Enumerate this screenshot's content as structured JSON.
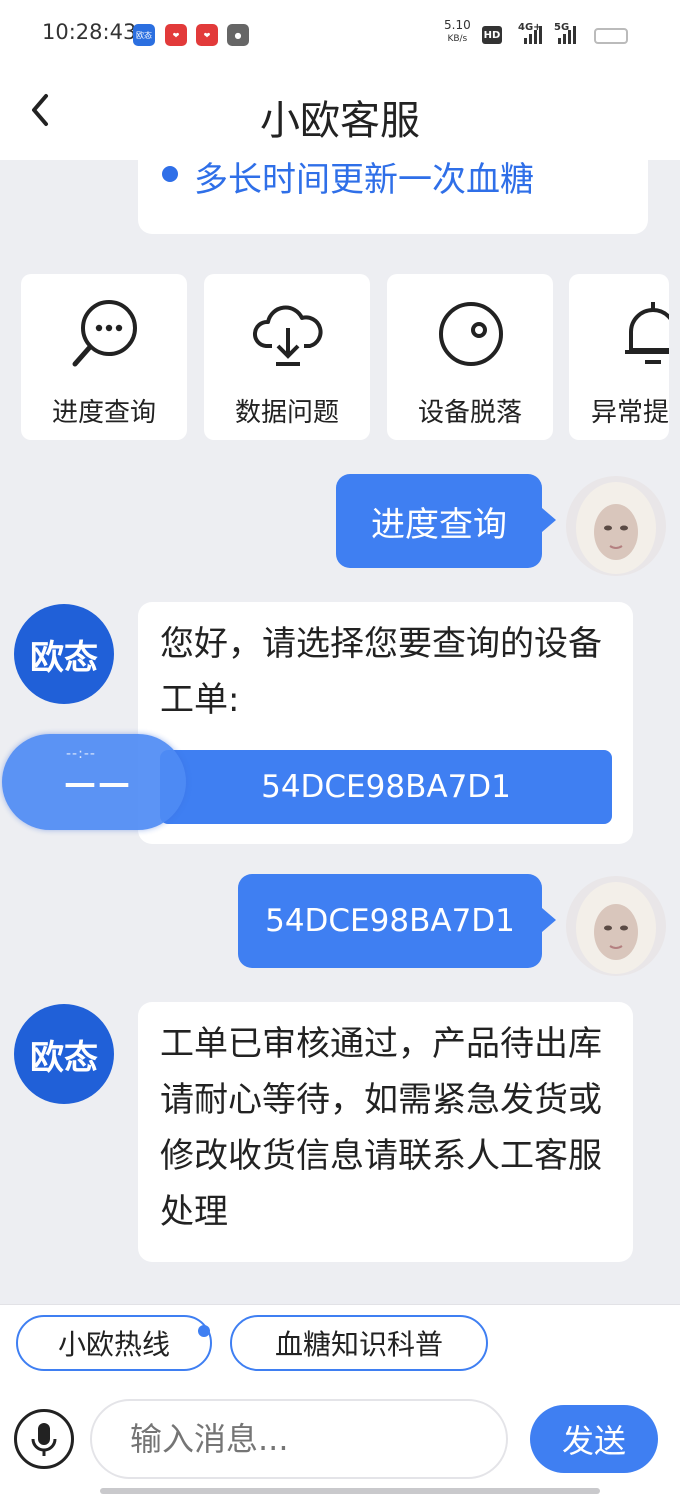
{
  "status_bar": {
    "time": "10:28:43",
    "apps": [
      {
        "name": "oudtai-app-icon",
        "label": "欧态",
        "color": "#2b6fe0"
      },
      {
        "name": "red-app-icon-1",
        "label": "",
        "color": "#e23a3a"
      },
      {
        "name": "red-app-icon-2",
        "label": "",
        "color": "#e23a3a"
      },
      {
        "name": "gray-app-icon",
        "label": "",
        "color": "#666666"
      }
    ],
    "net_speed_value": "5.10",
    "net_speed_unit": "KB/s",
    "hd_label": "HD",
    "sim_1": "4G+",
    "sim_2": "5G"
  },
  "header": {
    "back_icon": "chevron-left-icon",
    "title": "小欧客服"
  },
  "top_card": {
    "text": "多长时间更新一次血糖"
  },
  "quick_actions": [
    {
      "label": "进度查询",
      "icon": "search-chat-icon"
    },
    {
      "label": "数据问题",
      "icon": "cloud-download-icon"
    },
    {
      "label": "设备脱落",
      "icon": "disc-icon"
    },
    {
      "label": "异常提",
      "icon": "bell-icon"
    }
  ],
  "messages": {
    "user_1": "进度查询",
    "bot_avatar_label": "欧态",
    "bot_1": "您好，请选择您要查询的设备工单:",
    "order_button": "54DCE98BA7D1",
    "user_2": "54DCE98BA7D1",
    "bot_2": "工单已审核通过，产品待出库请耐心等待，如需紧急发货或修改收货信息请联系人工客服处理"
  },
  "floater": {
    "top": "--:--",
    "main": "——"
  },
  "bottom_bar": {
    "chips": [
      "小欧热线",
      "血糖知识科普"
    ],
    "input_placeholder": "输入消息...",
    "send_label": "发送"
  },
  "colors": {
    "accent": "#3f7ff2",
    "background": "#edeef2",
    "bot_avatar": "#2060d8"
  }
}
